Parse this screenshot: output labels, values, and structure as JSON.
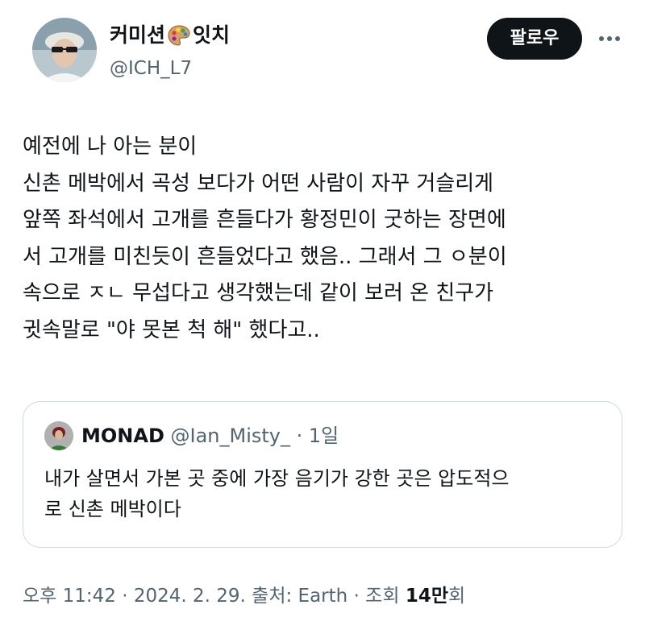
{
  "author": {
    "display_name_prefix": "커미션",
    "display_name_suffix": "잇치",
    "emoji_icon": "palette-icon",
    "handle": "@ICH_L7"
  },
  "actions": {
    "follow_label": "팔로우",
    "more_icon": "more-horizontal-icon"
  },
  "tweet": {
    "lines": [
      "예전에 나 아는 분이",
      "신촌 메박에서 곡성 보다가 어떤 사람이 자꾸 거슬리게",
      "앞쪽 좌석에서 고개를 흔들다가 황정민이 굿하는 장면에",
      "서 고개를 미친듯이 흔들었다고 했음.. 그래서 그 ㅇ분이",
      "속으로 ㅈㄴ 무섭다고 생각했는데 같이 보러 온 친구가",
      "귓속말로 \"야 못본 척 해\" 했다고.."
    ]
  },
  "quote": {
    "name": "MONAD",
    "handle": "@Ian_Misty_",
    "separator": " · ",
    "time": "1일",
    "lines": [
      "내가 살면서 가본 곳 중에 가장 음기가 강한 곳은 압도적으",
      "로 신촌 메박이다"
    ]
  },
  "meta": {
    "time": "오후 11:42",
    "date": "2024. 2. 29.",
    "source": "출처: Earth",
    "views_prefix": "조회 ",
    "views_count": "14만",
    "views_suffix": "회",
    "separator": " · "
  },
  "colors": {
    "text_primary": "#0f1419",
    "text_secondary": "#536471",
    "border": "#cfd9de",
    "button_bg": "#0f1419"
  }
}
